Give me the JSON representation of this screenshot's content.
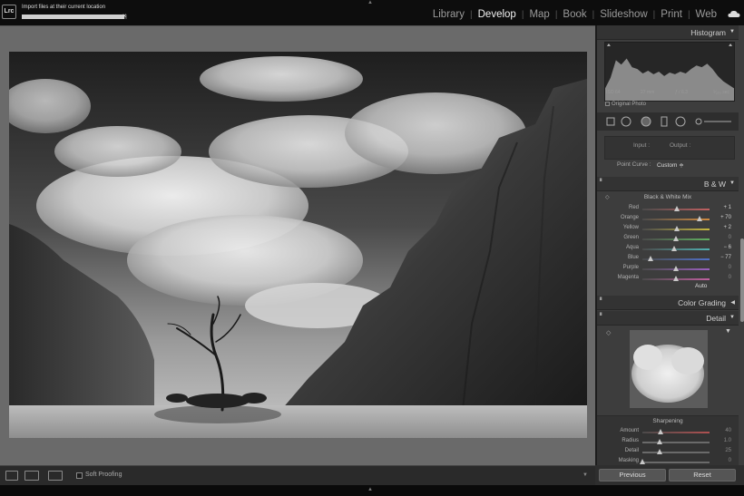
{
  "topbar": {
    "logo": "Lrc",
    "import_status": "Import files at their current location",
    "import_progress": 0.97,
    "close": "×",
    "modules": [
      "Library",
      "Develop",
      "Map",
      "Book",
      "Slideshow",
      "Print",
      "Web"
    ],
    "active_module": "Develop"
  },
  "histogram": {
    "title": "Histogram",
    "iso": "ISO 64",
    "focal": "27 mm",
    "aperture": "ƒ / 6.3",
    "shutter": "⅟₂₅₀ sec",
    "original_photo": "Original Photo"
  },
  "tone_curve": {
    "input": "Input :",
    "output": "Output :",
    "point_curve_label": "Point Curve :",
    "point_curve_value": "Custom ≑"
  },
  "bw": {
    "title": "B & W",
    "mix_title": "Black & White Mix",
    "sliders": [
      {
        "label": "Red",
        "value": "+ 1",
        "pos": 0.51,
        "active": true
      },
      {
        "label": "Orange",
        "value": "+ 70",
        "pos": 0.85,
        "active": true
      },
      {
        "label": "Yellow",
        "value": "+ 2",
        "pos": 0.51,
        "active": true
      },
      {
        "label": "Green",
        "value": "0",
        "pos": 0.5,
        "active": false
      },
      {
        "label": "Aqua",
        "value": "− 6",
        "pos": 0.47,
        "active": true
      },
      {
        "label": "Blue",
        "value": "− 77",
        "pos": 0.12,
        "active": true
      },
      {
        "label": "Purple",
        "value": "0",
        "pos": 0.5,
        "active": false
      },
      {
        "label": "Magenta",
        "value": "0",
        "pos": 0.5,
        "active": false
      }
    ],
    "auto": "Auto"
  },
  "color_grading": {
    "title": "Color Grading"
  },
  "detail": {
    "title": "Detail",
    "sharpening": "Sharpening",
    "sliders": [
      {
        "label": "Amount",
        "value": "40",
        "pos": 0.27
      },
      {
        "label": "Radius",
        "value": "1.0",
        "pos": 0.25
      },
      {
        "label": "Detail",
        "value": "25",
        "pos": 0.25
      },
      {
        "label": "Masking",
        "value": "0",
        "pos": 0.0
      }
    ]
  },
  "toolbar": {
    "soft_proofing": "Soft Proofing"
  },
  "buttons": {
    "previous": "Previous",
    "reset": "Reset"
  },
  "colors": {
    "accent_active": "#f2f2f2",
    "panel_bg": "#3d3d3d",
    "work_bg": "#6a6a6a"
  }
}
